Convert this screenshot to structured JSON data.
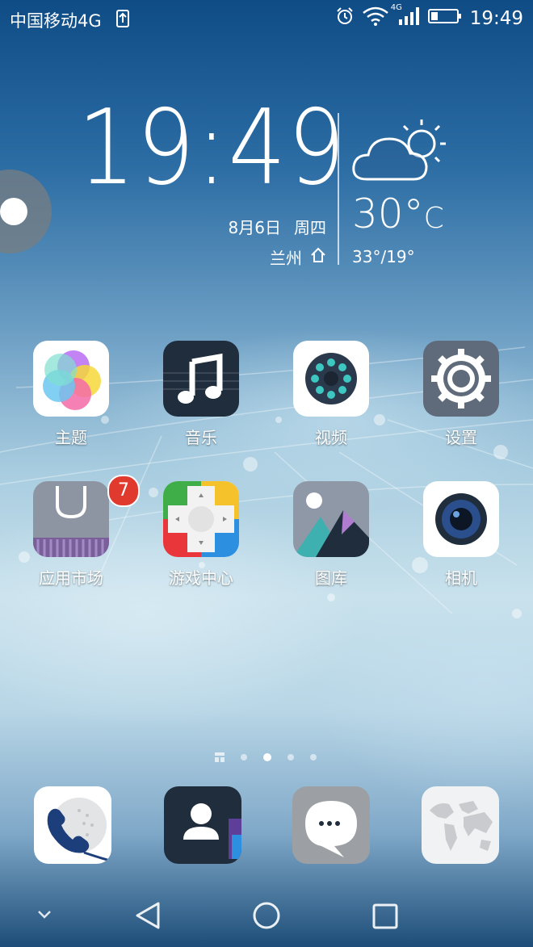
{
  "status_bar": {
    "carrier": "中国移动4G",
    "network_badge": "4G",
    "time": "19:49",
    "icons": [
      "usb-upload-icon",
      "alarm-icon",
      "wifi-icon",
      "signal-icon",
      "battery-icon"
    ]
  },
  "clock_widget": {
    "time": "19:49",
    "date": "8月6日",
    "weekday": "周四",
    "city": "兰州",
    "temperature": "30°",
    "temperature_unit": "C",
    "temp_range": "33°/19°",
    "weather_icon": "partly-cloudy-icon"
  },
  "apps": [
    {
      "label": "主题",
      "icon": "themes-icon"
    },
    {
      "label": "音乐",
      "icon": "music-icon"
    },
    {
      "label": "视频",
      "icon": "video-icon"
    },
    {
      "label": "设置",
      "icon": "settings-icon"
    },
    {
      "label": "应用市场",
      "icon": "app-market-icon",
      "badge": "7"
    },
    {
      "label": "游戏中心",
      "icon": "game-center-icon"
    },
    {
      "label": "图库",
      "icon": "gallery-icon"
    },
    {
      "label": "相机",
      "icon": "camera-icon"
    }
  ],
  "page_indicator": {
    "pages": 4,
    "active": 2
  },
  "dock": [
    {
      "icon": "phone-icon"
    },
    {
      "icon": "contacts-icon"
    },
    {
      "icon": "messages-icon"
    },
    {
      "icon": "browser-icon"
    }
  ],
  "nav_bar": {
    "icons": [
      "collapse-icon",
      "back-icon",
      "home-icon",
      "recents-icon"
    ]
  },
  "colors": {
    "badge": "#e03a2e",
    "settings_bg": "#5f6b7a",
    "music_bg": "#1f2d3d"
  }
}
